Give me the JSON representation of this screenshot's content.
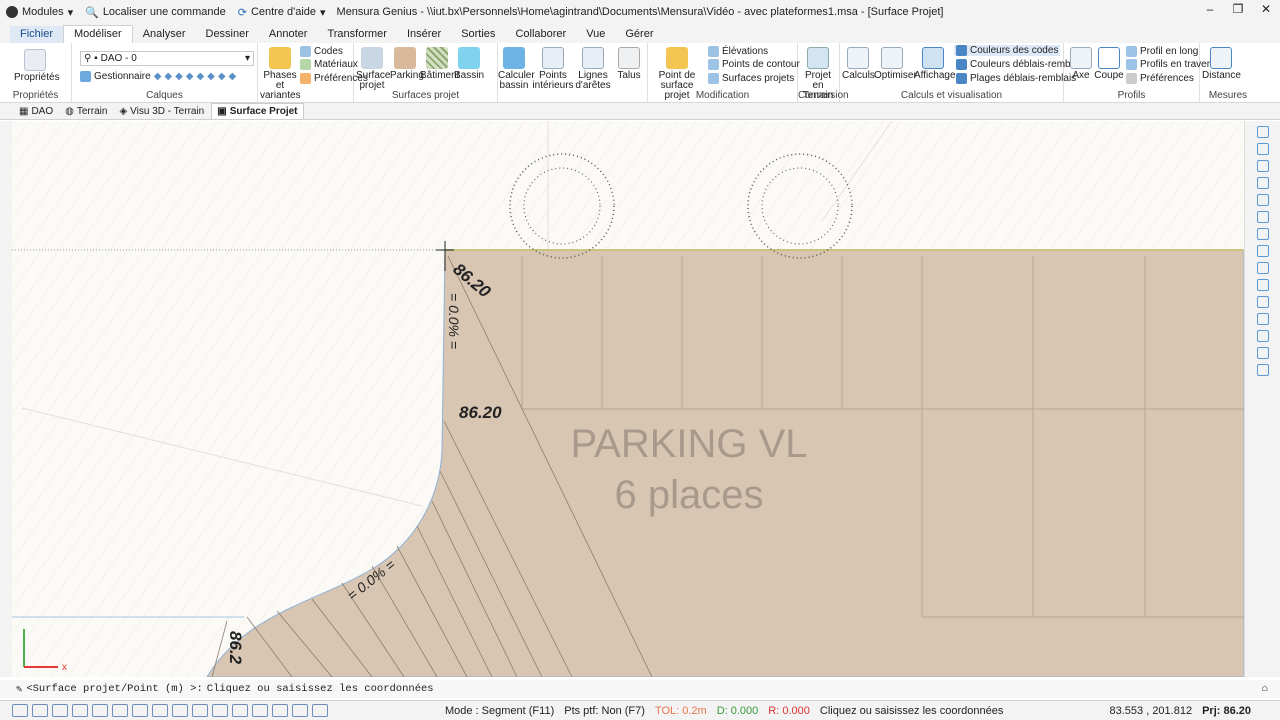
{
  "app": {
    "modules_label": "Modules",
    "search_label": "Localiser une commande",
    "help_label": "Centre d'aide",
    "title": "Mensura Genius - \\\\iut.bx\\Personnels\\Home\\agintrand\\Documents\\Mensura\\Vidéo - avec plateformes1.msa - [Surface Projet]"
  },
  "menu": [
    "Fichier",
    "Modéliser",
    "Analyser",
    "Dessiner",
    "Annoter",
    "Transformer",
    "Insérer",
    "Sorties",
    "Collaborer",
    "Vue",
    "Gérer"
  ],
  "ribbon": {
    "proprietes": {
      "btn": "Propriétés",
      "group": "Propriétés"
    },
    "calques": {
      "layer": "DAO - 0",
      "gest": "Gestionnaire",
      "group": "Calques"
    },
    "phases": {
      "btn1": "Phases et",
      "btn2": "variantes",
      "codes": "Codes",
      "materiaux": "Matériaux",
      "prefs": "Préférences"
    },
    "surfaces": {
      "surface1": "Surface",
      "surface2": "projet",
      "parking": "Parking",
      "batiment": "Bâtiment",
      "bassin": "Bassin",
      "group": "Surfaces projet"
    },
    "outils": {
      "calc1": "Calculer",
      "calc2": "bassin",
      "pts1": "Points",
      "pts2": "intérieurs",
      "lig1": "Lignes",
      "lig2": "d'arêtes",
      "talus": "Talus"
    },
    "modification": {
      "pt1": "Point de",
      "pt2": "surface projet",
      "elev": "Élévations",
      "contour": "Points de contour",
      "surfp": "Surfaces projets",
      "group": "Modification"
    },
    "conversion": {
      "b1": "Projet en",
      "b2": "Terrain",
      "group": "Conversion"
    },
    "calculs": {
      "calc": "Calculs",
      "opt": "Optimiser",
      "aff": "Affichage",
      "c1": "Couleurs des codes",
      "c2": "Couleurs déblais-remblais",
      "c3": "Plages déblais-remblais",
      "group": "Calculs et visualisation"
    },
    "profils": {
      "axe": "Axe",
      "coupe": "Coupe",
      "pl": "Profil en long",
      "pt": "Profils en travers",
      "pr": "Préférences",
      "group": "Profils"
    },
    "mesures": {
      "dist": "Distance",
      "group": "Mesures"
    }
  },
  "view_tabs": [
    "DAO",
    "Terrain",
    "Visu 3D - Terrain",
    "Surface Projet"
  ],
  "drawing": {
    "label_top": "86.20",
    "label_mid": "86.20",
    "label_bottom": "86.2",
    "slope_vertical": "= 0.0% =",
    "slope_curve": "= 0.0% =",
    "parking_line1": "PARKING VL",
    "parking_line2": "6 places",
    "axis_x": "x",
    "colors": {
      "fill": "#d8c6b3",
      "edge": "#c9c57e",
      "grid": "#9e9080"
    }
  },
  "command": {
    "prompt": "<Surface projet/Point (m) >:",
    "text": "Cliquez ou saisissez les coordonnées"
  },
  "status": {
    "mode": "Mode : Segment (F11)",
    "pts": "Pts ptf: Non (F7)",
    "tol": "TOL: 0.2m",
    "d": "D: 0.000",
    "r": "R: 0.000",
    "msg": "Cliquez ou saisissez les coordonnées",
    "coords": "83.553 , 201.812",
    "prj": "Prj: 86.20"
  }
}
